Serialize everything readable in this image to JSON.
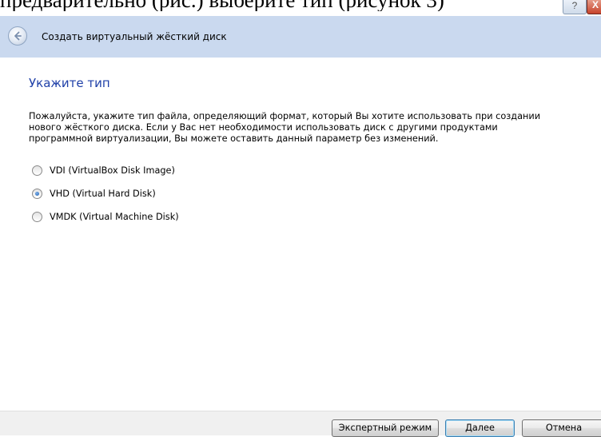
{
  "background_document": {
    "text": "предварительно (рис.) выберите тип (рисунок 3)"
  },
  "window_controls": {
    "help_label": "?",
    "close_label": "X"
  },
  "header": {
    "title": "Создать виртуальный жёсткий диск",
    "back_icon": "back-arrow-icon"
  },
  "page": {
    "heading": "Укажите тип",
    "description_lines": [
      "Пожалуйста, укажите тип файла, определяющий формат, который Вы хотите использовать при создании",
      "нового жёсткого диска. Если у Вас нет необходимости использовать диск с другими продуктами",
      "программной виртуализации, Вы можете оставить данный параметр без изменений."
    ],
    "options": [
      {
        "label": "VDI (VirtualBox Disk Image)",
        "checked": false
      },
      {
        "label": "VHD (Virtual Hard Disk)",
        "checked": true
      },
      {
        "label": "VMDK (Virtual Machine Disk)",
        "checked": false
      }
    ]
  },
  "footer": {
    "expert_label": "Экспертный режим",
    "next_label": "Далее",
    "cancel_label": "Отмена"
  },
  "colors": {
    "header_bg": "#cad9ef",
    "heading": "#1e3fa8"
  }
}
